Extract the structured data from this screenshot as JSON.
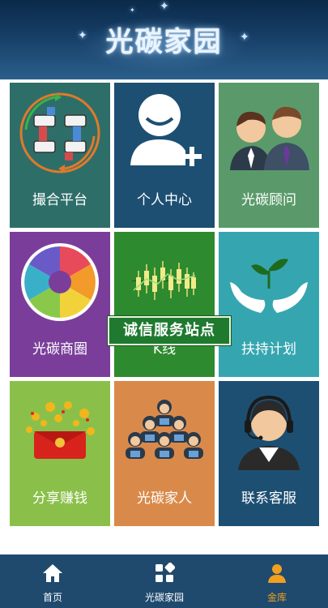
{
  "header": {
    "title": "光碳家园"
  },
  "tiles": [
    {
      "label": "撮合平台",
      "color": "#2e6e69",
      "icon": "handshake-ring-icon"
    },
    {
      "label": "个人中心",
      "color": "#1d4f72",
      "icon": "user-add-icon"
    },
    {
      "label": "光碳顾问",
      "color": "#5a9a6a",
      "icon": "consultants-icon"
    },
    {
      "label": "光碳商圈",
      "color": "#7a3e9a",
      "icon": "aperture-icon"
    },
    {
      "label": "K线",
      "color": "#2e8a2e",
      "icon": "candlestick-icon"
    },
    {
      "label": "扶持计划",
      "color": "#35a6b0",
      "icon": "hands-sprout-icon"
    },
    {
      "label": "分享赚钱",
      "color": "#8ac04a",
      "icon": "red-envelope-coins-icon"
    },
    {
      "label": "光碳家人",
      "color": "#d98a4a",
      "icon": "people-group-icon"
    },
    {
      "label": "联系客服",
      "color": "#1d4f72",
      "icon": "customer-service-icon"
    }
  ],
  "overlay": {
    "banner_text": "诚信服务站点"
  },
  "bottom_nav": {
    "items": [
      {
        "label": "首页",
        "icon": "home-icon"
      },
      {
        "label": "光碳家园",
        "icon": "apps-icon"
      },
      {
        "label": "金库",
        "icon": "user-icon",
        "active": true
      }
    ],
    "active_color": "#f0a020"
  }
}
